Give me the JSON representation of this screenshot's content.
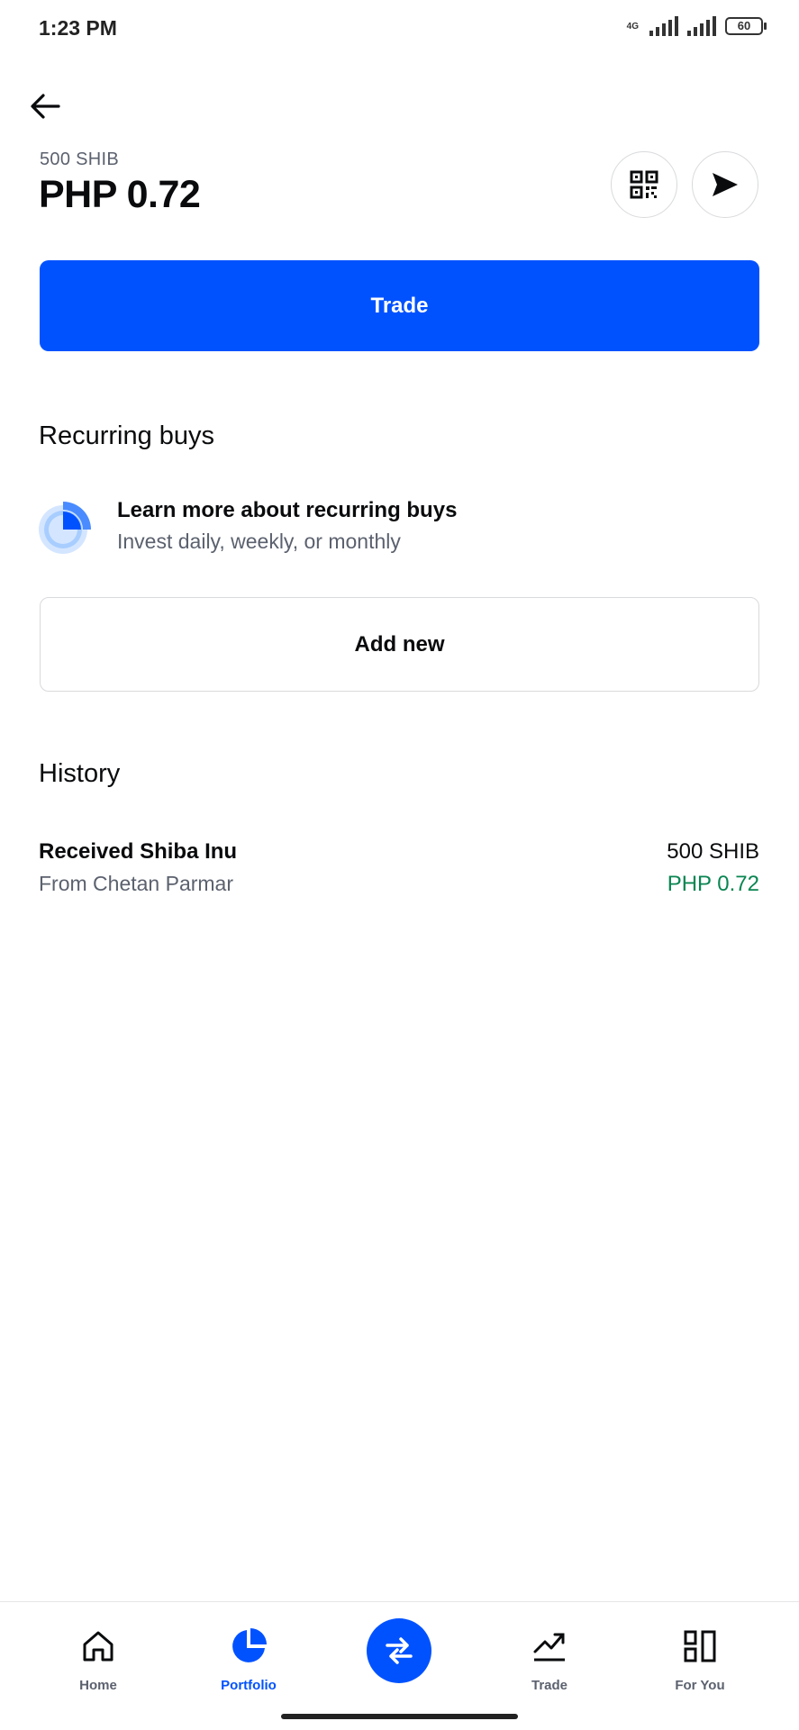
{
  "status_bar": {
    "time": "1:23 PM",
    "network": "4G",
    "battery": "60"
  },
  "header": {
    "crypto_balance": "500 SHIB",
    "fiat_balance": "PHP 0.72"
  },
  "actions": {
    "trade_label": "Trade"
  },
  "recurring": {
    "title": "Recurring buys",
    "learn_title": "Learn more about recurring buys",
    "learn_subtitle": "Invest daily, weekly, or monthly",
    "add_label": "Add new"
  },
  "history": {
    "title": "History",
    "items": [
      {
        "name": "Received Shiba Inu",
        "from": "From Chetan Parmar",
        "amount": "500 SHIB",
        "value": "PHP 0.72"
      }
    ]
  },
  "nav": {
    "items": [
      {
        "label": "Home",
        "icon": "home-icon"
      },
      {
        "label": "Portfolio",
        "icon": "pie-chart-icon",
        "active": true
      },
      {
        "label": "Trade",
        "icon": "trend-up-icon"
      },
      {
        "label": "For You",
        "icon": "layout-icon"
      }
    ]
  },
  "colors": {
    "accent": "#0052ff",
    "positive": "#098551",
    "muted": "#5b616e"
  }
}
